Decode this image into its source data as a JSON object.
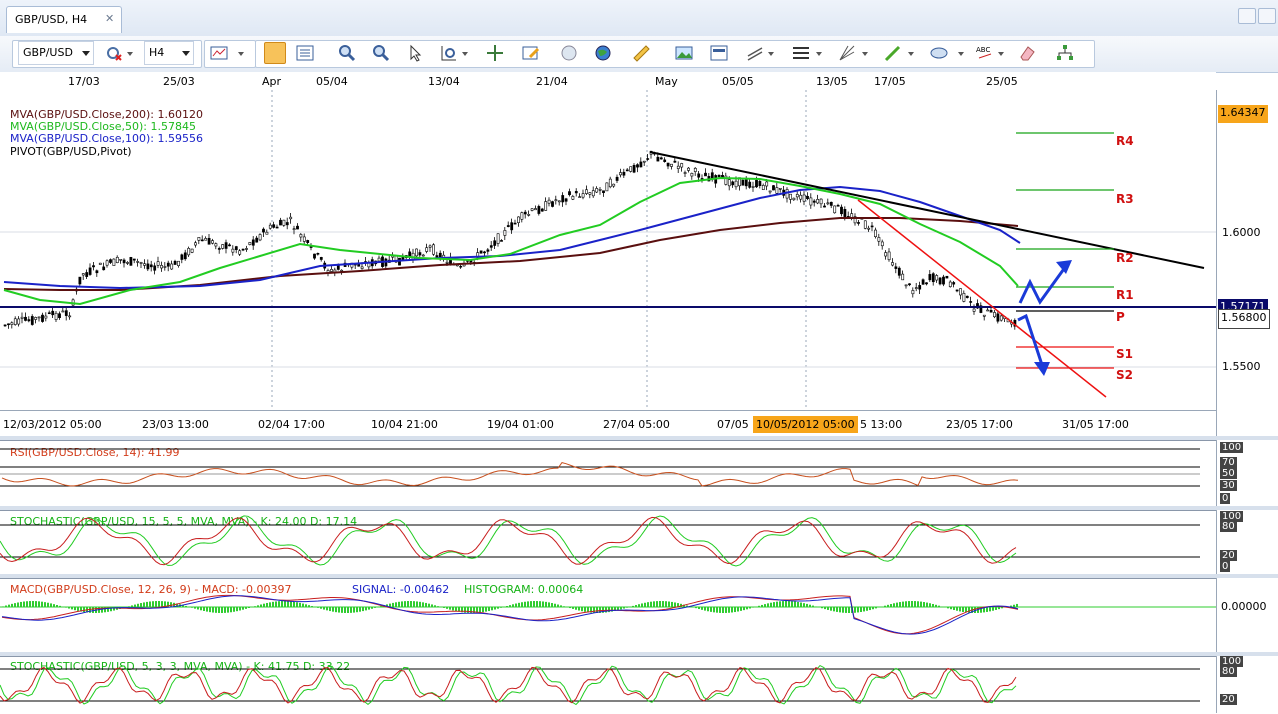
{
  "tab": {
    "title": "GBP/USD, H4",
    "close": "✕"
  },
  "toolbar": {
    "symbol": "GBP/USD",
    "timeframe": "H4"
  },
  "top_dates": [
    "17/03",
    "25/03",
    "Apr",
    "05/04",
    "13/04",
    "21/04",
    "May",
    "05/05",
    "13/05",
    "17/05",
    "25/05"
  ],
  "bottom_dates": [
    "12/03/2012 05:00",
    "23/03 13:00",
    "02/04 17:00",
    "10/04 21:00",
    "19/04 01:00",
    "27/04 05:00",
    "07/05",
    "10/05/2012 05:00",
    "5 13:00",
    "23/05 17:00",
    "31/05 17:00"
  ],
  "legend": [
    {
      "text": "MVA(GBP/USD.Close,200): 1.60120",
      "color": "#5a0f0f"
    },
    {
      "text": "MVA(GBP/USD.Close,50): 1.57845",
      "color": "#22cc22"
    },
    {
      "text": "MVA(GBP/USD.Close,100): 1.59556",
      "color": "#1a22c8"
    },
    {
      "text": "PIVOT(GBP/USD,Pivot)",
      "color": "#000000"
    }
  ],
  "price_axis": {
    "top_badge": "1.64347",
    "badge_mid": "1.57171",
    "badge_last": "1.56800",
    "ticks": [
      "1.6000",
      "1.5500"
    ]
  },
  "pivots": [
    "R4",
    "R3",
    "R2",
    "R1",
    "P",
    "S1",
    "S2"
  ],
  "panels": {
    "rsi": {
      "title": "RSI(GBP/USD.Close, 14): 41.99",
      "ticks": [
        "100",
        "70",
        "50",
        "30",
        "0"
      ]
    },
    "stoch1": {
      "title": "STOCHASTIC(GBP/USD, 15, 5, 5, MVA, MVA) - K: 24.00 D: 17.14",
      "ticks": [
        "100",
        "80",
        "20",
        "0"
      ]
    },
    "macd": {
      "title_a": "MACD(GBP/USD.Close, 12, 26, 9) - MACD: -0.00397",
      "title_b": "SIGNAL: -0.00462",
      "title_c": "HISTOGRAM: 0.00064",
      "ticks": [
        "0.00000"
      ]
    },
    "stoch2": {
      "title": "STOCHASTIC(GBP/USD, 5, 3, 3, MVA, MVA) - K: 41.75 D: 33.22",
      "ticks": [
        "100",
        "80",
        "20"
      ]
    }
  },
  "colors": {
    "accent_orange": "#f7a51a",
    "axis_grey": "#555555"
  }
}
